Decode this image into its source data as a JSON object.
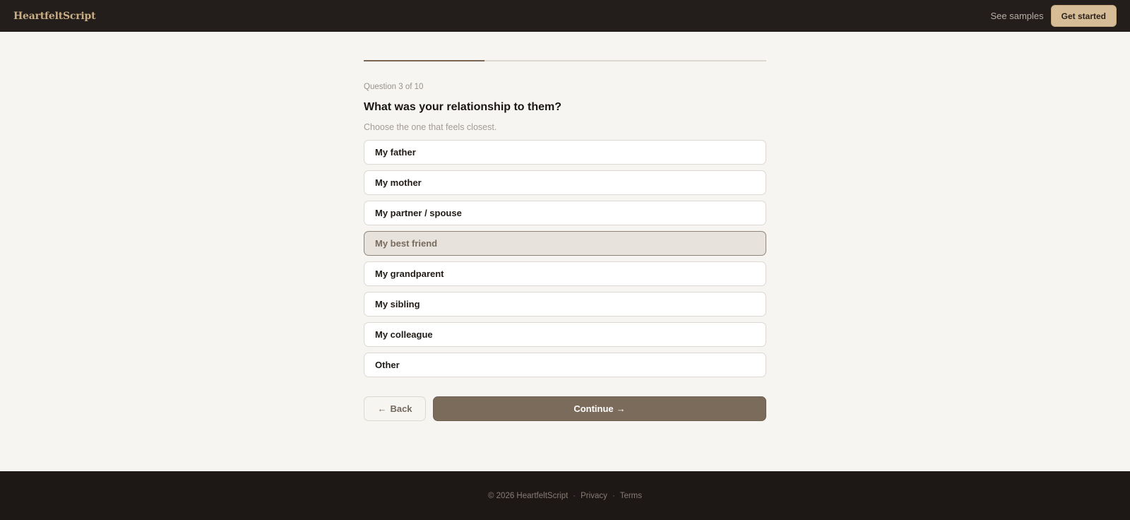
{
  "header": {
    "logo": "HeartfeltScript",
    "see_samples": "See samples",
    "get_started": "Get started"
  },
  "progress": {
    "fraction": 0.3
  },
  "question": {
    "counter": "Question 3 of 10",
    "title": "What was your relationship to them?",
    "hint": "Choose the one that feels closest.",
    "options": [
      {
        "label": "My father",
        "selected": false
      },
      {
        "label": "My mother",
        "selected": false
      },
      {
        "label": "My partner / spouse",
        "selected": false
      },
      {
        "label": "My best friend",
        "selected": true
      },
      {
        "label": "My grandparent",
        "selected": false
      },
      {
        "label": "My sibling",
        "selected": false
      },
      {
        "label": "My colleague",
        "selected": false
      },
      {
        "label": "Other",
        "selected": false
      }
    ]
  },
  "actions": {
    "back": "Back",
    "continue": "Continue"
  },
  "footer": {
    "copyright": "© 2026 HeartfeltScript",
    "privacy": "Privacy",
    "terms": "Terms"
  },
  "colors": {
    "accent": "#7a6b5b",
    "topbar": "#231e1b",
    "cta": "#d6bd97"
  }
}
